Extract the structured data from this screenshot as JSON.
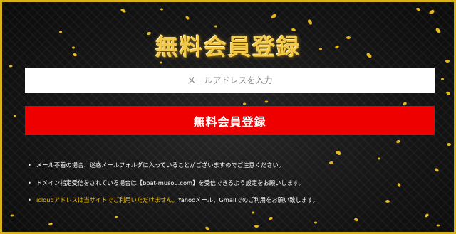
{
  "title": "無料会員登録",
  "email": {
    "placeholder": "メールアドレスを入力",
    "value": ""
  },
  "register_button": "無料会員登録",
  "notes": [
    {
      "text": "メール不着の場合、迷惑メールフォルダに入っていることがございますのでご注意ください。"
    },
    {
      "text": "ドメイン指定受信をされている場合は【boat-musou.com】を受信できるよう設定をお願いします。"
    },
    {
      "highlight": "icloudアドレスは当サイトでご利用いただけません。",
      "text": "Yahooメール、Gmailでのご利用をお願い致します。"
    }
  ],
  "colors": {
    "border": "#d7b21a",
    "title_gold": "#f3c94a",
    "button_red": "#ee0000",
    "highlight_yellow": "#f2c200",
    "background": "#121212"
  },
  "icons": [
    "gold-confetti"
  ]
}
